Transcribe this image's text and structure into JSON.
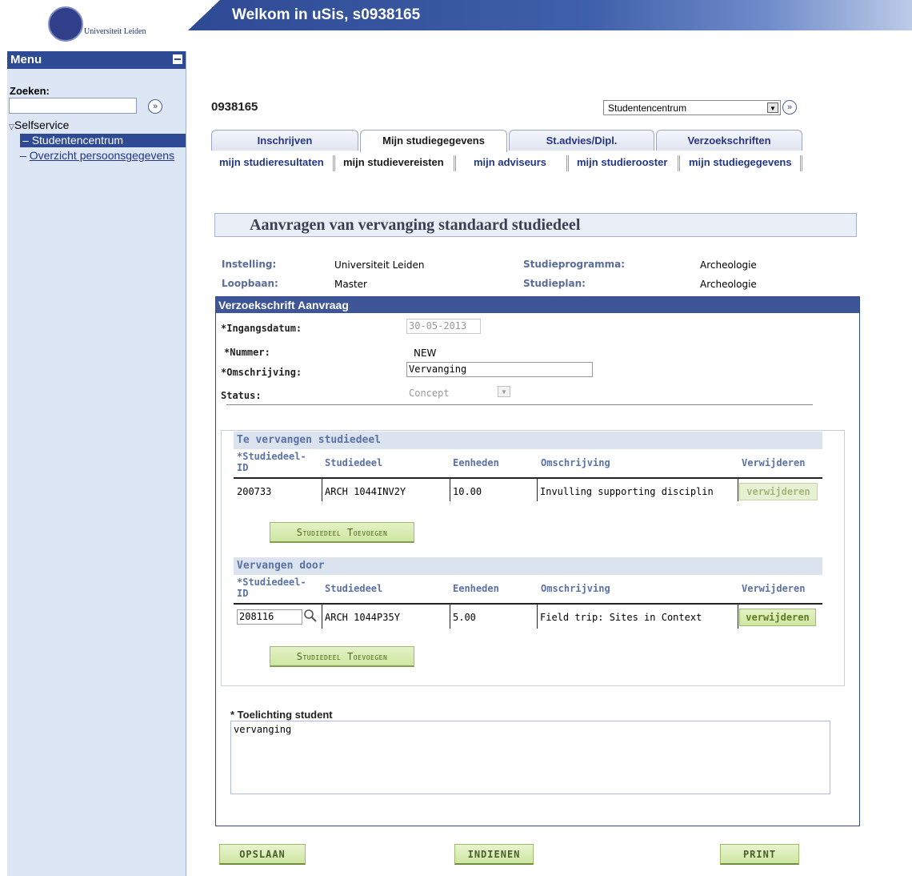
{
  "header": {
    "university": "Universiteit Leiden",
    "banner_title": "Welkom in uSis, s0938165"
  },
  "sidebar": {
    "menu_title": "Menu",
    "search_label": "Zoeken:",
    "search_value": "",
    "tree": {
      "root": "Selfservice",
      "items": [
        {
          "label": "Studentencentrum",
          "active": true
        },
        {
          "label": "Overzicht persoonsgegevens",
          "active": false
        }
      ]
    }
  },
  "topbar": {
    "student_id": "0938165",
    "navigate_select": "Studentencentrum"
  },
  "tabs": [
    {
      "label": "Inschrijven",
      "active": false
    },
    {
      "label": "Mijn studiegegevens",
      "active": true
    },
    {
      "label": "St.advies/Dipl.",
      "active": false
    },
    {
      "label": "Verzoekschriften",
      "active": false
    }
  ],
  "subtabs": [
    {
      "label": "mijn studieresultaten",
      "active": false
    },
    {
      "label": "mijn studievereisten",
      "active": true
    },
    {
      "label": "mijn adviseurs",
      "active": false
    },
    {
      "label": "mijn studierooster",
      "active": false
    },
    {
      "label": "mijn studiegegevens",
      "active": false
    }
  ],
  "page_title": "Aanvragen van vervanging standaard studiedeel",
  "info": {
    "instelling_label": "Instelling:",
    "instelling_value": "Universiteit Leiden",
    "loopbaan_label": "Loopbaan:",
    "loopbaan_value": "Master",
    "studieprogramma_label": "Studieprogramma:",
    "studieprogramma_value": "Archeologie",
    "studieplan_label": "Studieplan:",
    "studieplan_value": "Archeologie"
  },
  "request": {
    "section_title": "Verzoekschrift Aanvraag",
    "ingangsdatum_label": "*Ingangsdatum:",
    "ingangsdatum_value": "30-05-2013",
    "nummer_label": "*Nummer:",
    "nummer_value": "NEW",
    "omschrijving_label": "*Omschrijving:",
    "omschrijving_value": "Vervanging",
    "status_label": "Status:",
    "status_value": "Concept"
  },
  "grid_columns": {
    "id": "*Studiedeel-ID",
    "id_line1": "*Studiedeel-",
    "id_line2": "ID",
    "studiedeel": "Studiedeel",
    "eenheden": "Eenheden",
    "omschrijving": "Omschrijving",
    "verwijderen": "Verwijderen"
  },
  "te_vervangen": {
    "title": "Te vervangen studiedeel",
    "rows": [
      {
        "id": "200733",
        "studiedeel": "ARCH 1044INV2Y",
        "eenheden": "10.00",
        "omschrijving": "Invulling supporting disciplin",
        "action": "verwijderen"
      }
    ],
    "add_button": "Studiedeel Toevoegen"
  },
  "vervangen_door": {
    "title": "Vervangen door",
    "rows": [
      {
        "id": "208116",
        "studiedeel": "ARCH 1044P35Y",
        "eenheden": "5.00",
        "omschrijving": "Field trip: Sites in Context",
        "action": "verwijderen"
      }
    ],
    "add_button": "Studiedeel Toevoegen"
  },
  "toelichting": {
    "label": "* Toelichting student",
    "value": "vervanging"
  },
  "buttons": {
    "save": "OPSLAAN",
    "submit": "INDIENEN",
    "print": "PRINT"
  }
}
